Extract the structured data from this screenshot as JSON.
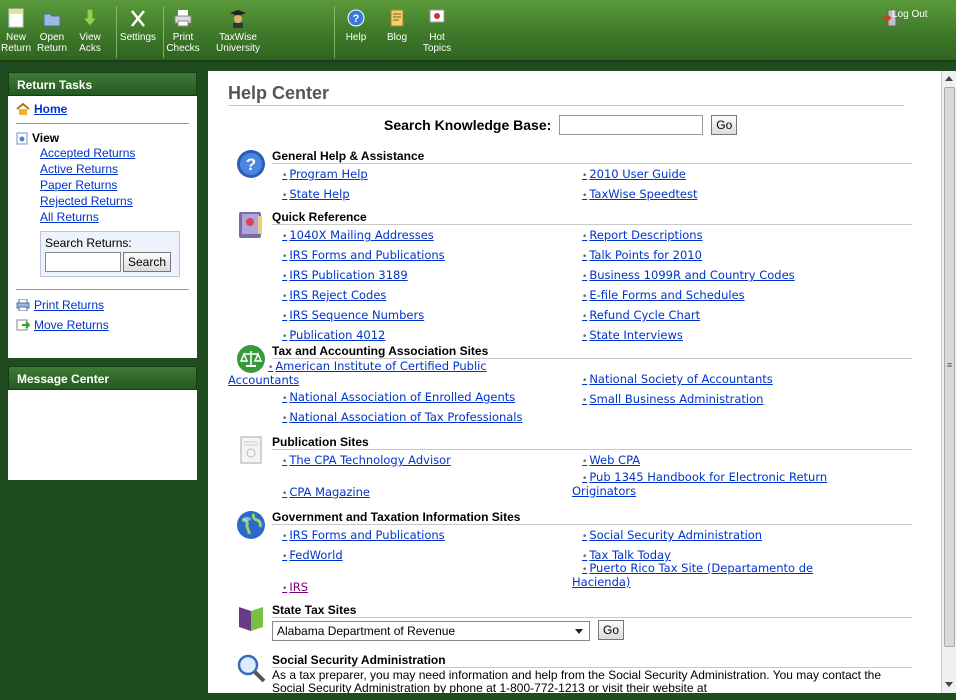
{
  "toolbar": {
    "items": [
      {
        "label": "New\nReturn",
        "icon": "new-return-icon"
      },
      {
        "label": "Open\nReturn",
        "icon": "open-folder-icon"
      },
      {
        "label": "View\nAcks",
        "icon": "down-arrow-icon"
      },
      {
        "label": "Settings",
        "icon": "tools-icon"
      },
      {
        "label": "Print\nChecks",
        "icon": "printer-icon"
      },
      {
        "label": "TaxWise\nUniversity",
        "icon": "graduate-icon"
      },
      {
        "label": "Help",
        "icon": "help-icon"
      },
      {
        "label": "Blog",
        "icon": "scroll-icon"
      },
      {
        "label": "Hot\nTopics",
        "icon": "hot-topics-icon"
      }
    ],
    "logout_label": "Log Out"
  },
  "sidebar": {
    "tasks_title": "Return Tasks",
    "home_label": "Home",
    "view_label": "View",
    "view_links": [
      "Accepted Returns",
      "Active Returns",
      "Paper Returns",
      "Rejected Returns",
      "All Returns"
    ],
    "search_label": "Search Returns:",
    "search_button": "Search",
    "print_label": "Print Returns",
    "move_label": "Move Returns",
    "message_title": "Message Center"
  },
  "main": {
    "title": "Help Center",
    "kb_label": "Search Knowledge Base:",
    "kb_go": "Go",
    "sections": {
      "general": {
        "title": "General Help & Assistance",
        "left": [
          "Program Help",
          "State Help"
        ],
        "right": [
          "2010 User Guide",
          "TaxWise Speedtest"
        ]
      },
      "quick": {
        "title": "Quick Reference",
        "left": [
          "1040X Mailing Addresses",
          "IRS Forms and Publications",
          "IRS Publication 3189",
          "IRS Reject Codes",
          "IRS Sequence Numbers",
          "Publication 4012"
        ],
        "right": [
          "Report Descriptions",
          "Talk Points for 2010",
          "Business 1099R and Country Codes",
          "E-file Forms and Schedules",
          "Refund Cycle Chart",
          "State Interviews"
        ]
      },
      "assoc": {
        "title": "Tax and Accounting Association Sites",
        "left1": "American Institute of Certified Public",
        "left1b": "Accountants",
        "left": [
          "National Association of Enrolled Agents",
          "National Association of Tax Professionals"
        ],
        "right": [
          "National Society of Accountants",
          "Small Business Administration"
        ]
      },
      "pubs": {
        "title": "Publication Sites",
        "left": [
          "The CPA Technology Advisor",
          "CPA Magazine"
        ],
        "right1": "Web CPA",
        "right2": "Pub 1345 Handbook for Electronic Return",
        "right2b": "Originators"
      },
      "gov": {
        "title": "Government and Taxation Information Sites",
        "left": [
          "IRS Forms and Publications",
          "FedWorld",
          "IRS"
        ],
        "right": [
          "Social Security Administration",
          "Tax Talk Today"
        ],
        "right3": "Puerto Rico Tax Site (Departamento de",
        "right3b": "Hacienda)"
      },
      "state": {
        "title": "State Tax Sites",
        "selected": "Alabama Department of Revenue",
        "go": "Go"
      },
      "ssa": {
        "title": "Social Security Administration",
        "text": "As a tax preparer, you may need information and help from the Social Security Administration. You may contact the Social Security Administration by phone at 1-800-772-1213 or visit their website at"
      }
    }
  },
  "colors": {
    "toolbar": "#3f7a2a",
    "sidebar_bg": "#1f4d1f",
    "link": "#0033cc",
    "visited": "#800080"
  }
}
